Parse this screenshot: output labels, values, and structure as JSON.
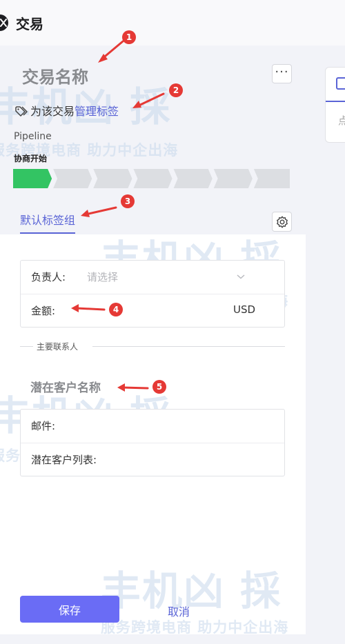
{
  "header": {
    "title": "交易"
  },
  "deal": {
    "name": "交易名称",
    "more_label": "···",
    "tag_prefix": "为该交易",
    "tag_link": "管理标签"
  },
  "pipeline": {
    "label": "Pipeline",
    "stage": "协商开始",
    "total_segments": 7,
    "completed_segments": 1
  },
  "tabs": {
    "default_group": "默认标签组"
  },
  "fields": {
    "owner_label": "负责人:",
    "owner_placeholder": "请选择",
    "amount_label": "金额:",
    "currency": "USD"
  },
  "contact": {
    "section_label": "主要联系人",
    "lead_name": "潜在客户名称",
    "email_label": "邮件:",
    "lead_list_label": "潜在客户列表:"
  },
  "actions": {
    "save": "保存",
    "cancel": "取消"
  },
  "right_panel": {
    "card_text": "点"
  },
  "annotations": [
    "1",
    "2",
    "3",
    "4",
    "5"
  ],
  "watermark": {
    "brand": "丰机凶 採",
    "slogan": "服务跨境电商 助力中企出海"
  },
  "colors": {
    "accent": "#5a64d6",
    "save_button": "#6a6cf5",
    "pipeline_done": "#33c463",
    "pipeline_todo": "#dcdee2",
    "annotation": "#e53935"
  }
}
